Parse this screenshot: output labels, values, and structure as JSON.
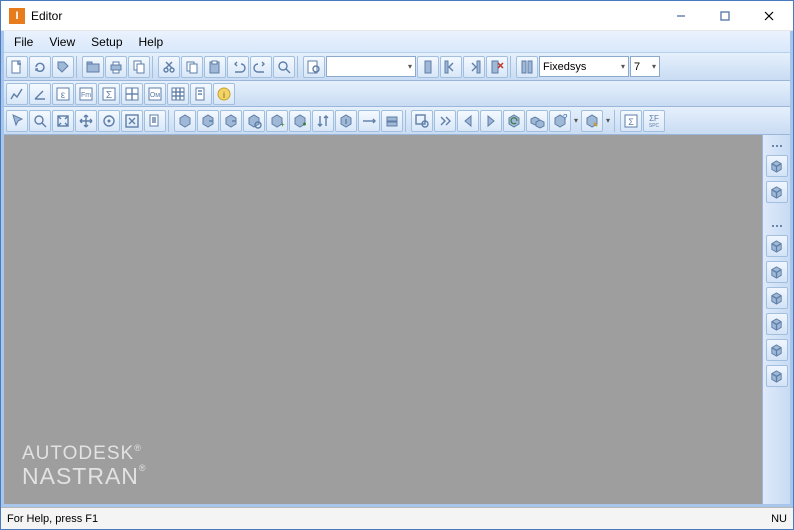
{
  "title": "Editor",
  "menus": [
    "File",
    "View",
    "Setup",
    "Help"
  ],
  "font_name": "Fixedsys",
  "font_size": "7",
  "status_text": "For Help, press F1",
  "status_right": "NU",
  "watermark_line1": "AUTODESK",
  "watermark_line2": "NASTRAN",
  "toolbar1": [
    "new",
    "refresh",
    "tag",
    "open",
    "print",
    "copy-all",
    "cut",
    "copy",
    "paste",
    "undo",
    "redo",
    "zoom",
    "sep",
    "find"
  ],
  "toolbar2": [
    "graph",
    "angle",
    "epsilon",
    "fm",
    "sigma",
    "matrix",
    "om",
    "grid",
    "doc",
    "info"
  ],
  "toolbar3": [
    "pointer",
    "zoom-window",
    "fit",
    "pan",
    "center",
    "fit-page",
    "layers",
    "box1",
    "box-out",
    "box-in",
    "filter",
    "add-grid",
    "box-plus",
    "sort",
    "box-arrow",
    "move",
    "stack",
    "find-box",
    "chevron",
    "arrow-l",
    "arrow-r",
    "box-refresh",
    "boxes",
    "help-box",
    "sep",
    "edit-box",
    "sep",
    "sigma-box",
    "sigma-spc"
  ],
  "rightbar_top": [
    "cube1",
    "cube2"
  ],
  "rightbar_bottom": [
    "cube-a",
    "cube-b",
    "cube-c",
    "cube-d",
    "cube-e",
    "cube-f"
  ]
}
